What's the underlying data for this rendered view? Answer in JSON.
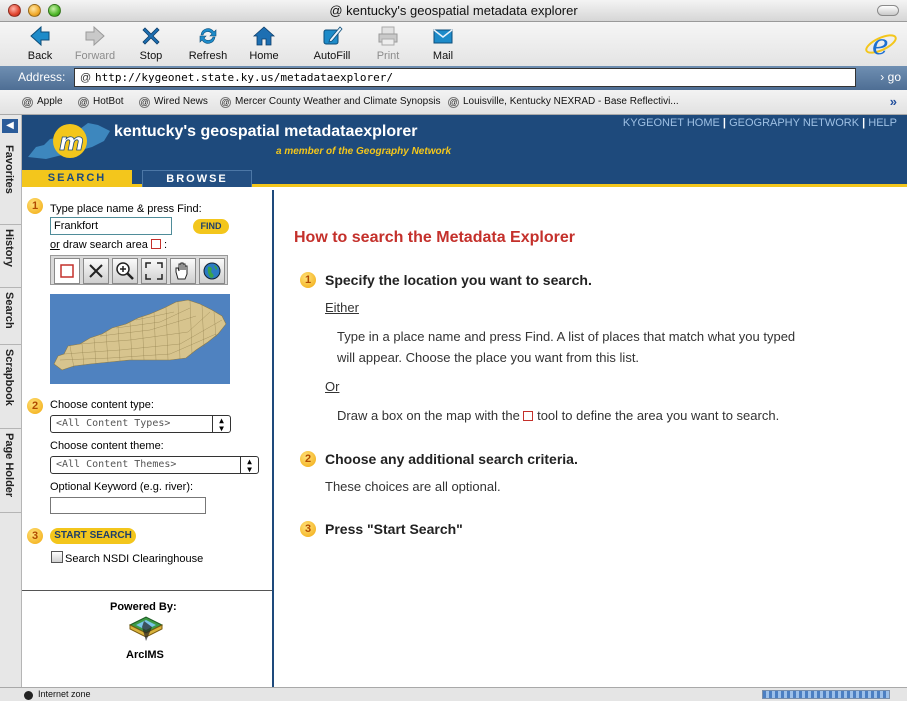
{
  "window": {
    "title": "kentucky's geospatial metadata explorer"
  },
  "toolbar": {
    "back": "Back",
    "forward": "Forward",
    "stop": "Stop",
    "refresh": "Refresh",
    "home": "Home",
    "autofill": "AutoFill",
    "print": "Print",
    "mail": "Mail"
  },
  "address": {
    "label": "Address:",
    "url": "http://kygeonet.state.ky.us/metadataexplorer/",
    "go": "go"
  },
  "favorites": [
    "Apple",
    "HotBot",
    "Wired News",
    "Mercer County Weather and Climate Synopsis",
    "Louisville,  Kentucky  NEXRAD - Base Reflectivi..."
  ],
  "sidebar_tabs": [
    "Favorites",
    "History",
    "Search",
    "Scrapbook",
    "Page Holder"
  ],
  "header": {
    "title": "kentucky's geospatial metadataexplorer",
    "subtitle": "a member of the Geography Network",
    "link_kygeonet": "KYGEONET HOME",
    "sep1": "|",
    "link_geonet": "GEOGRAPHY NETWORK",
    "sep2": "|",
    "link_help": "HELP"
  },
  "tabs": {
    "search": "SEARCH",
    "browse": "BROWSE"
  },
  "search_panel": {
    "step1_num": "1",
    "place_label": "Type place name & press Find:",
    "place_value": "Frankfort",
    "find": "FIND",
    "or_text": "or",
    "draw_label": " draw search area",
    "draw_colon": ":",
    "step2_num": "2",
    "content_type_label": "Choose content type:",
    "content_type_value": "<All Content Types>",
    "content_theme_label": "Choose content theme:",
    "content_theme_value": "<All Content Themes>",
    "keyword_label": "Optional Keyword (e.g. river):",
    "keyword_value": "",
    "step3_num": "3",
    "start_search": "START SEARCH",
    "nsdi_label": "Search NSDI Clearinghouse",
    "powered_by": "Powered By:",
    "arcims": "ArcIMS"
  },
  "help": {
    "title": "How to search the Metadata Explorer",
    "step1_num": "1",
    "step1_title": "Specify the location you want to search.",
    "either": "Either",
    "type_text_1": "Type in a place name and press Find. A list of places that match what you typed",
    "type_text_2": "will appear. Choose the place you want from this list.",
    "or": "Or",
    "draw_text_a": "Draw a box on the map with the",
    "draw_text_b": "tool to define the area you want to search.",
    "step2_num": "2",
    "step2_title": "Choose any additional search criteria.",
    "step2_text": "These choices are all optional.",
    "step3_num": "3",
    "step3_title": "Press \"Start Search\""
  },
  "status": {
    "text": "Internet zone"
  },
  "colors": {
    "navy": "#1e4a7c",
    "gold": "#f3c61c",
    "heading_red": "#c4302b"
  }
}
